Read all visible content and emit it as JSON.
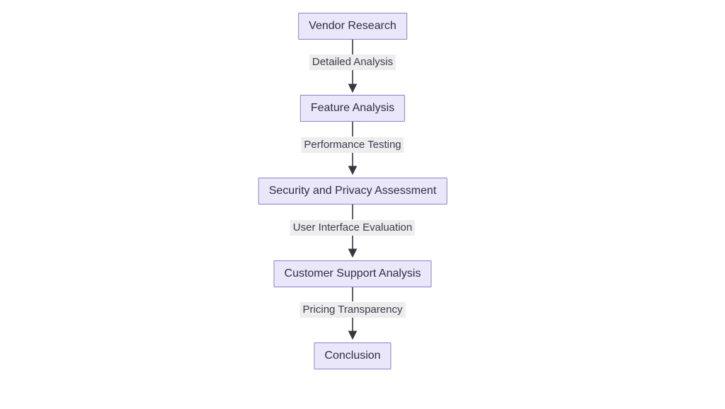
{
  "diagram": {
    "nodes": {
      "vendor_research": "Vendor Research",
      "feature_analysis": "Feature Analysis",
      "security_privacy": "Security and Privacy Assessment",
      "customer_support": "Customer Support Analysis",
      "conclusion": "Conclusion"
    },
    "edges": {
      "e1": "Detailed Analysis",
      "e2": "Performance Testing",
      "e3": "User Interface Evaluation",
      "e4": "Pricing Transparency"
    }
  },
  "chart_data": {
    "type": "flowchart",
    "direction": "top-to-bottom",
    "nodes": [
      {
        "id": "vendor_research",
        "label": "Vendor Research"
      },
      {
        "id": "feature_analysis",
        "label": "Feature Analysis"
      },
      {
        "id": "security_privacy",
        "label": "Security and Privacy Assessment"
      },
      {
        "id": "customer_support",
        "label": "Customer Support Analysis"
      },
      {
        "id": "conclusion",
        "label": "Conclusion"
      }
    ],
    "edges": [
      {
        "from": "vendor_research",
        "to": "feature_analysis",
        "label": "Detailed Analysis"
      },
      {
        "from": "feature_analysis",
        "to": "security_privacy",
        "label": "Performance Testing"
      },
      {
        "from": "security_privacy",
        "to": "customer_support",
        "label": "User Interface Evaluation"
      },
      {
        "from": "customer_support",
        "to": "conclusion",
        "label": "Pricing Transparency"
      }
    ],
    "node_style": {
      "fill": "#ebe7fb",
      "stroke": "#8d80c8"
    },
    "edge_label_style": {
      "fill": "#ededed"
    }
  }
}
